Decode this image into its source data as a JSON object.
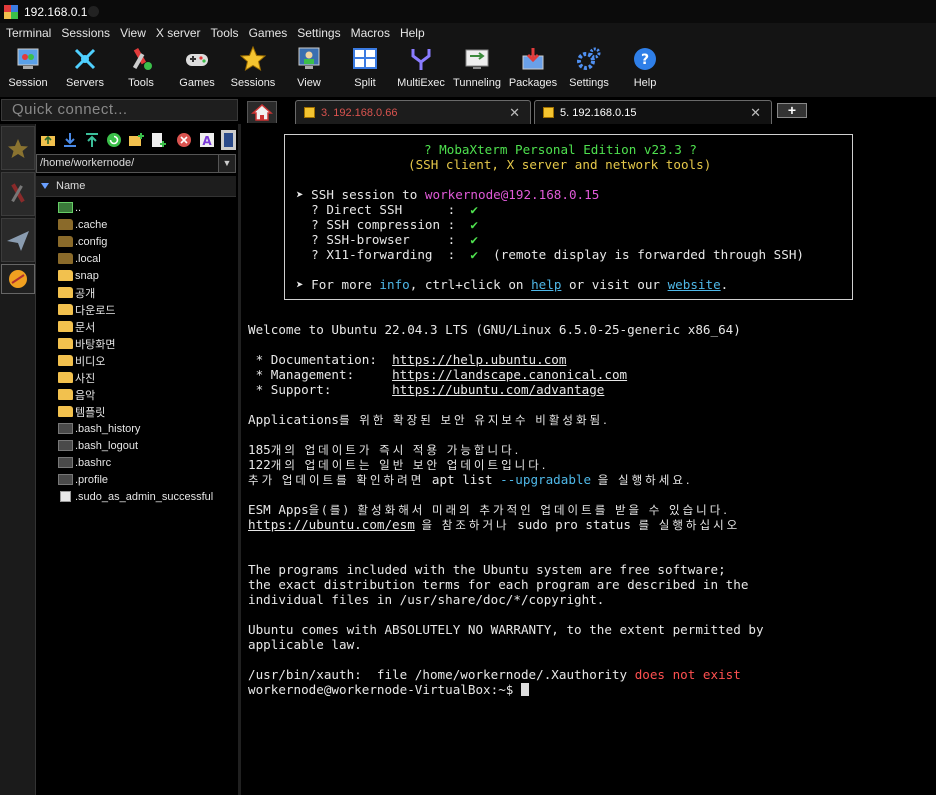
{
  "window": {
    "title": "192.168.0.1"
  },
  "menu": [
    "Terminal",
    "Sessions",
    "View",
    "X server",
    "Tools",
    "Games",
    "Settings",
    "Macros",
    "Help"
  ],
  "toolbar": [
    "Session",
    "Servers",
    "Tools",
    "Games",
    "Sessions",
    "View",
    "Split",
    "MultiExec",
    "Tunneling",
    "Packages",
    "Settings",
    "Help"
  ],
  "quick_connect": {
    "placeholder": "Quick connect..."
  },
  "tabs": [
    {
      "label": "3. 192.168.0.66",
      "close": "✕"
    },
    {
      "label": "5. 192.168.0.15",
      "close": "✕"
    }
  ],
  "add_tab": "+",
  "filebrowser": {
    "path": "/home/workernode/",
    "column": "Name",
    "items": [
      {
        "name": "..",
        "kind": "up"
      },
      {
        "name": ".cache",
        "kind": "hfolder"
      },
      {
        "name": ".config",
        "kind": "hfolder"
      },
      {
        "name": ".local",
        "kind": "hfolder"
      },
      {
        "name": "snap",
        "kind": "folder"
      },
      {
        "name": "공개",
        "kind": "folder"
      },
      {
        "name": "다운로드",
        "kind": "folder"
      },
      {
        "name": "문서",
        "kind": "folder"
      },
      {
        "name": "바탕화면",
        "kind": "folder"
      },
      {
        "name": "비디오",
        "kind": "folder"
      },
      {
        "name": "사진",
        "kind": "folder"
      },
      {
        "name": "음악",
        "kind": "folder"
      },
      {
        "name": "템플릿",
        "kind": "folder"
      },
      {
        "name": ".bash_history",
        "kind": "file"
      },
      {
        "name": ".bash_logout",
        "kind": "file"
      },
      {
        "name": ".bashrc",
        "kind": "file"
      },
      {
        "name": ".profile",
        "kind": "file"
      },
      {
        "name": ".sudo_as_admin_successful",
        "kind": "doc"
      }
    ]
  },
  "terminal": {
    "banner": {
      "title": "? MobaXterm Personal Edition v23.3 ?",
      "subtitle": "(SSH client, X server and network tools)",
      "ssh_prefix": "➤ SSH session to ",
      "ssh_target": "workernode@192.168.0.15",
      "opts": [
        {
          "label": "  ? Direct SSH      :  ",
          "mark": "✔",
          "note": ""
        },
        {
          "label": "  ? SSH compression :  ",
          "mark": "✔",
          "note": ""
        },
        {
          "label": "  ? SSH-browser     :  ",
          "mark": "✔",
          "note": ""
        },
        {
          "label": "  ? X11-forwarding  :  ",
          "mark": "✔",
          "note": "  (remote display is forwarded through SSH)"
        }
      ],
      "more_a": "➤ For more ",
      "more_info": "info",
      "more_b": ", ctrl+click on ",
      "more_help": "help",
      "more_c": " or visit our ",
      "more_site": "website",
      "more_d": "."
    },
    "welcome": "Welcome to Ubuntu 22.04.3 LTS (GNU/Linux 6.5.0-25-generic x86_64)",
    "doc_label": " * Documentation:  ",
    "doc_url": "https://help.ubuntu.com",
    "mgmt_label": " * Management:     ",
    "mgmt_url": "https://landscape.canonical.com",
    "support_label": " * Support:        ",
    "support_url": "https://ubuntu.com/advantage",
    "apps_a": "Applications",
    "apps_kr": "를 위한 확장된 보안 유지보수 비활성화됨.",
    "upd1_n": "185",
    "upd1_kr": "개의 업데이트가 즉시 적용 가능합니다.",
    "upd2_n": "122",
    "upd2_kr": "개의 업데이트는 일반 보안 업데이트입니다.",
    "upd3_kr": "추가 업데이트를 확인하려면",
    "upd3_cmd": " apt list ",
    "upd3_flag": "--upgradable",
    "upd3_kr2": " 을 실행하세요.",
    "esm_a": "ESM Apps",
    "esm_kr": "을(를) 활성화해서 미래의 추가적인 업데이트를 받을 수 있습니다.",
    "esm_url": "https://ubuntu.com/esm",
    "esm_kr2": " 을 참조하거나",
    "esm_cmd": " sudo pro status ",
    "esm_kr3": "를 실행하십시오",
    "free1": "The programs included with the Ubuntu system are free software;",
    "free2": "the exact distribution terms for each program are described in the",
    "free3": "individual files in /usr/share/doc/*/copyright.",
    "warr1": "Ubuntu comes with ABSOLUTELY NO WARRANTY, to the extent permitted by",
    "warr2": "applicable law.",
    "xauth_a": "/usr/bin/xauth:  file /home/workernode/.Xauthority ",
    "xauth_b": "does not exist",
    "prompt": "workernode@workernode-VirtualBox:~$ "
  },
  "colors": {
    "accent_green": "#4ee04e",
    "accent_cyan": "#4fb8e8",
    "error_red": "#ff5050",
    "host_magenta": "#e05ad8"
  }
}
